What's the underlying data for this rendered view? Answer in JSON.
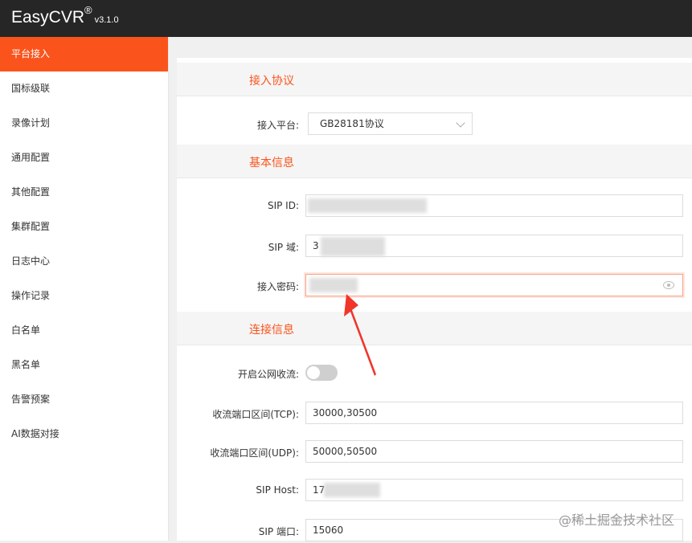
{
  "header": {
    "brand": "EasyCVR",
    "reg": "®",
    "version": "v3.1.0"
  },
  "sidebar": {
    "items": [
      {
        "label": "平台接入"
      },
      {
        "label": "国标级联"
      },
      {
        "label": "录像计划"
      },
      {
        "label": "通用配置"
      },
      {
        "label": "其他配置"
      },
      {
        "label": "集群配置"
      },
      {
        "label": "日志中心"
      },
      {
        "label": "操作记录"
      },
      {
        "label": "白名单"
      },
      {
        "label": "黑名单"
      },
      {
        "label": "告警预案"
      },
      {
        "label": "AI数据对接"
      }
    ]
  },
  "sections": {
    "protocol": "接入协议",
    "basic": "基本信息",
    "connect": "连接信息"
  },
  "form": {
    "platform_label": "接入平台:",
    "platform_value": "GB28181协议",
    "sip_id_label": "SIP ID:",
    "sip_domain_label": "SIP 域:",
    "sip_domain_value": "3",
    "password_label": "接入密码:",
    "public_stream_label": "开启公网收流:",
    "tcp_label": "收流端口区间(TCP):",
    "tcp_value": "30000,30500",
    "udp_label": "收流端口区间(UDP):",
    "udp_value": "50000,50500",
    "host_label": "SIP Host:",
    "host_value": "17",
    "port_label": "SIP 端口:",
    "port_value": "15060"
  },
  "watermark": "@稀土掘金技术社区",
  "colors": {
    "accent": "#fa541c",
    "topbar": "#262626"
  },
  "icons": {
    "select": "chevron-down-icon",
    "password": "eye-icon"
  }
}
